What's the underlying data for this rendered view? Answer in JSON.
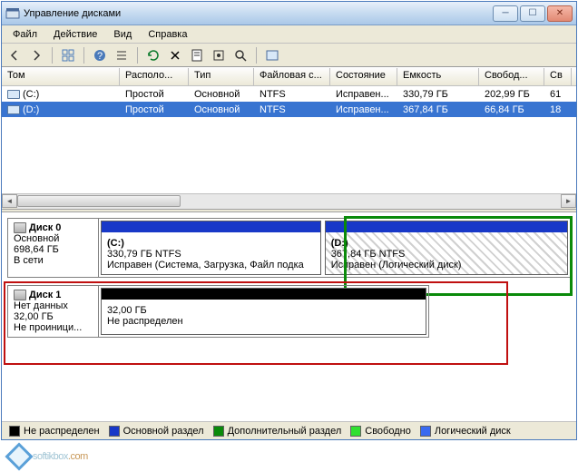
{
  "window": {
    "title": "Управление дисками"
  },
  "menu": {
    "file": "Файл",
    "action": "Действие",
    "view": "Вид",
    "help": "Справка"
  },
  "columns": {
    "vol": "Том",
    "layout": "Располо...",
    "type": "Тип",
    "fs": "Файловая с...",
    "status": "Состояние",
    "capacity": "Емкость",
    "free": "Свобод...",
    "pctfree": "Св"
  },
  "rows": [
    {
      "vol": "(C:)",
      "layout": "Простой",
      "type": "Основной",
      "fs": "NTFS",
      "status": "Исправен...",
      "capacity": "330,79 ГБ",
      "free": "202,99 ГБ",
      "pctfree": "61"
    },
    {
      "vol": "(D:)",
      "layout": "Простой",
      "type": "Основной",
      "fs": "NTFS",
      "status": "Исправен...",
      "capacity": "367,84 ГБ",
      "free": "66,84 ГБ",
      "pctfree": "18"
    }
  ],
  "disks": [
    {
      "name": "Диск 0",
      "type": "Основной",
      "size": "698,64 ГБ",
      "status": "В сети",
      "parts": [
        {
          "label": "(C:)",
          "info1": "330,79 ГБ NTFS",
          "info2": "Исправен (Система, Загрузка, Файл подка"
        },
        {
          "label": "(D:)",
          "info1": "367,84 ГБ NTFS",
          "info2": "Исправен (Логический диск)"
        }
      ]
    },
    {
      "name": "Диск 1",
      "type": "Нет данных",
      "size": "32,00 ГБ",
      "status": "Не проиници...",
      "parts": [
        {
          "label": "",
          "info1": "32,00 ГБ",
          "info2": "Не распределен"
        }
      ]
    }
  ],
  "legend": {
    "unalloc": "Не распределен",
    "primary": "Основной раздел",
    "extended": "Дополнительный раздел",
    "free": "Свободно",
    "logical": "Логический диск"
  },
  "colors": {
    "unalloc": "#000000",
    "primary": "#1838c8",
    "extended": "#0a8a0a",
    "free": "#30e030",
    "logical": "#3a6af0"
  },
  "watermark": {
    "text": "softikbox",
    "dom": ".com"
  }
}
